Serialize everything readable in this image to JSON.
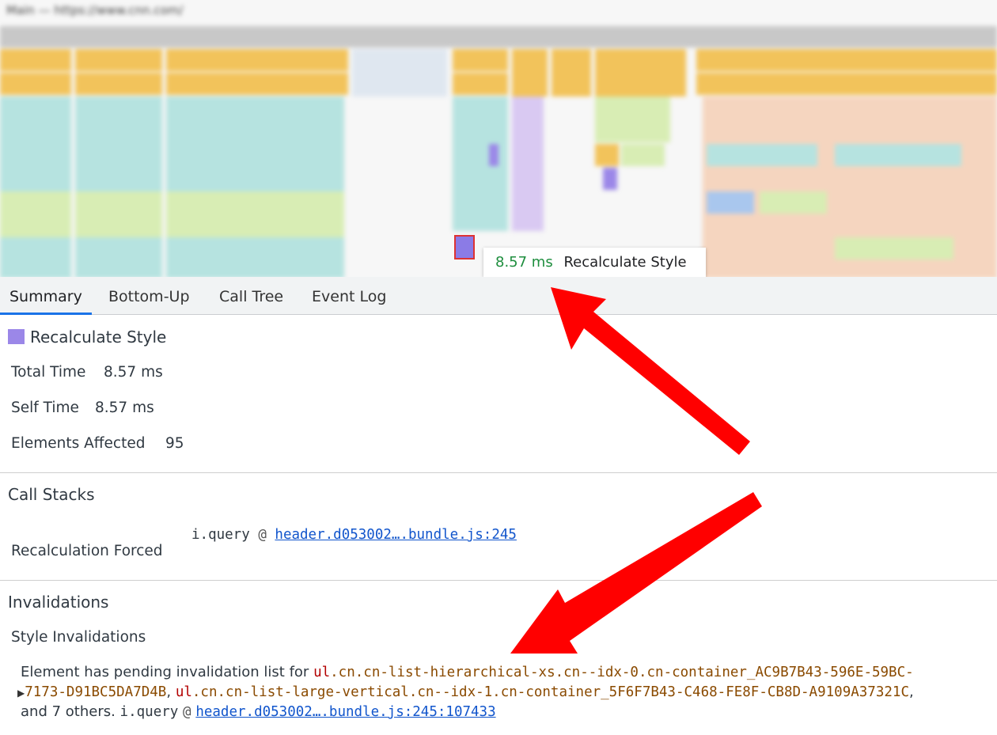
{
  "flame": {
    "thread_title": "Main — https://www.cnn.com/",
    "tooltip_ms": "8.57 ms",
    "tooltip_name": "Recalculate Style",
    "colors": {
      "task": "#c8c8c8",
      "script": "#f2c35b",
      "style": "#9b87e8",
      "teal": "#b6e3e0",
      "green": "#d8edb4",
      "peach": "#f5d5bf"
    }
  },
  "tabs": [
    "Summary",
    "Bottom-Up",
    "Call Tree",
    "Event Log"
  ],
  "summary": {
    "title": "Recalculate Style",
    "rows": [
      {
        "label": "Total Time",
        "value": "8.57 ms"
      },
      {
        "label": "Self Time",
        "value": "8.57 ms"
      },
      {
        "label": "Elements Affected",
        "value": "95"
      }
    ]
  },
  "call_stacks": {
    "heading": "Call Stacks",
    "label": "Recalculation Forced",
    "fn": "i.query",
    "at": "@",
    "link": "header.d053002….bundle.js:245"
  },
  "invalidations": {
    "heading": "Invalidations",
    "subheading": "Style Invalidations",
    "prefix": "Element has pending invalidation list for ",
    "sel1_tag": "ul",
    "sel1_rest": ".cn.cn-list-hierarchical-xs.cn--idx-0.cn-container_AC9B7B43-596E-59BC-",
    "sel1_cont": "7173-D91BC5DA7D4B",
    "comma1": ", ",
    "sel2_tag": "ul",
    "sel2_rest": ".cn.cn-list-large-vertical.cn--idx-1.cn-container_5F6F7B43-C468-FE8F-CB8D-A9109A37321C",
    "comma2": ",",
    "suffix": "and 7 others.",
    "fn": "i.query",
    "at": "@",
    "link": "header.d053002….bundle.js:245:107433"
  },
  "annotation": {
    "arrow_color": "#ff0000"
  }
}
